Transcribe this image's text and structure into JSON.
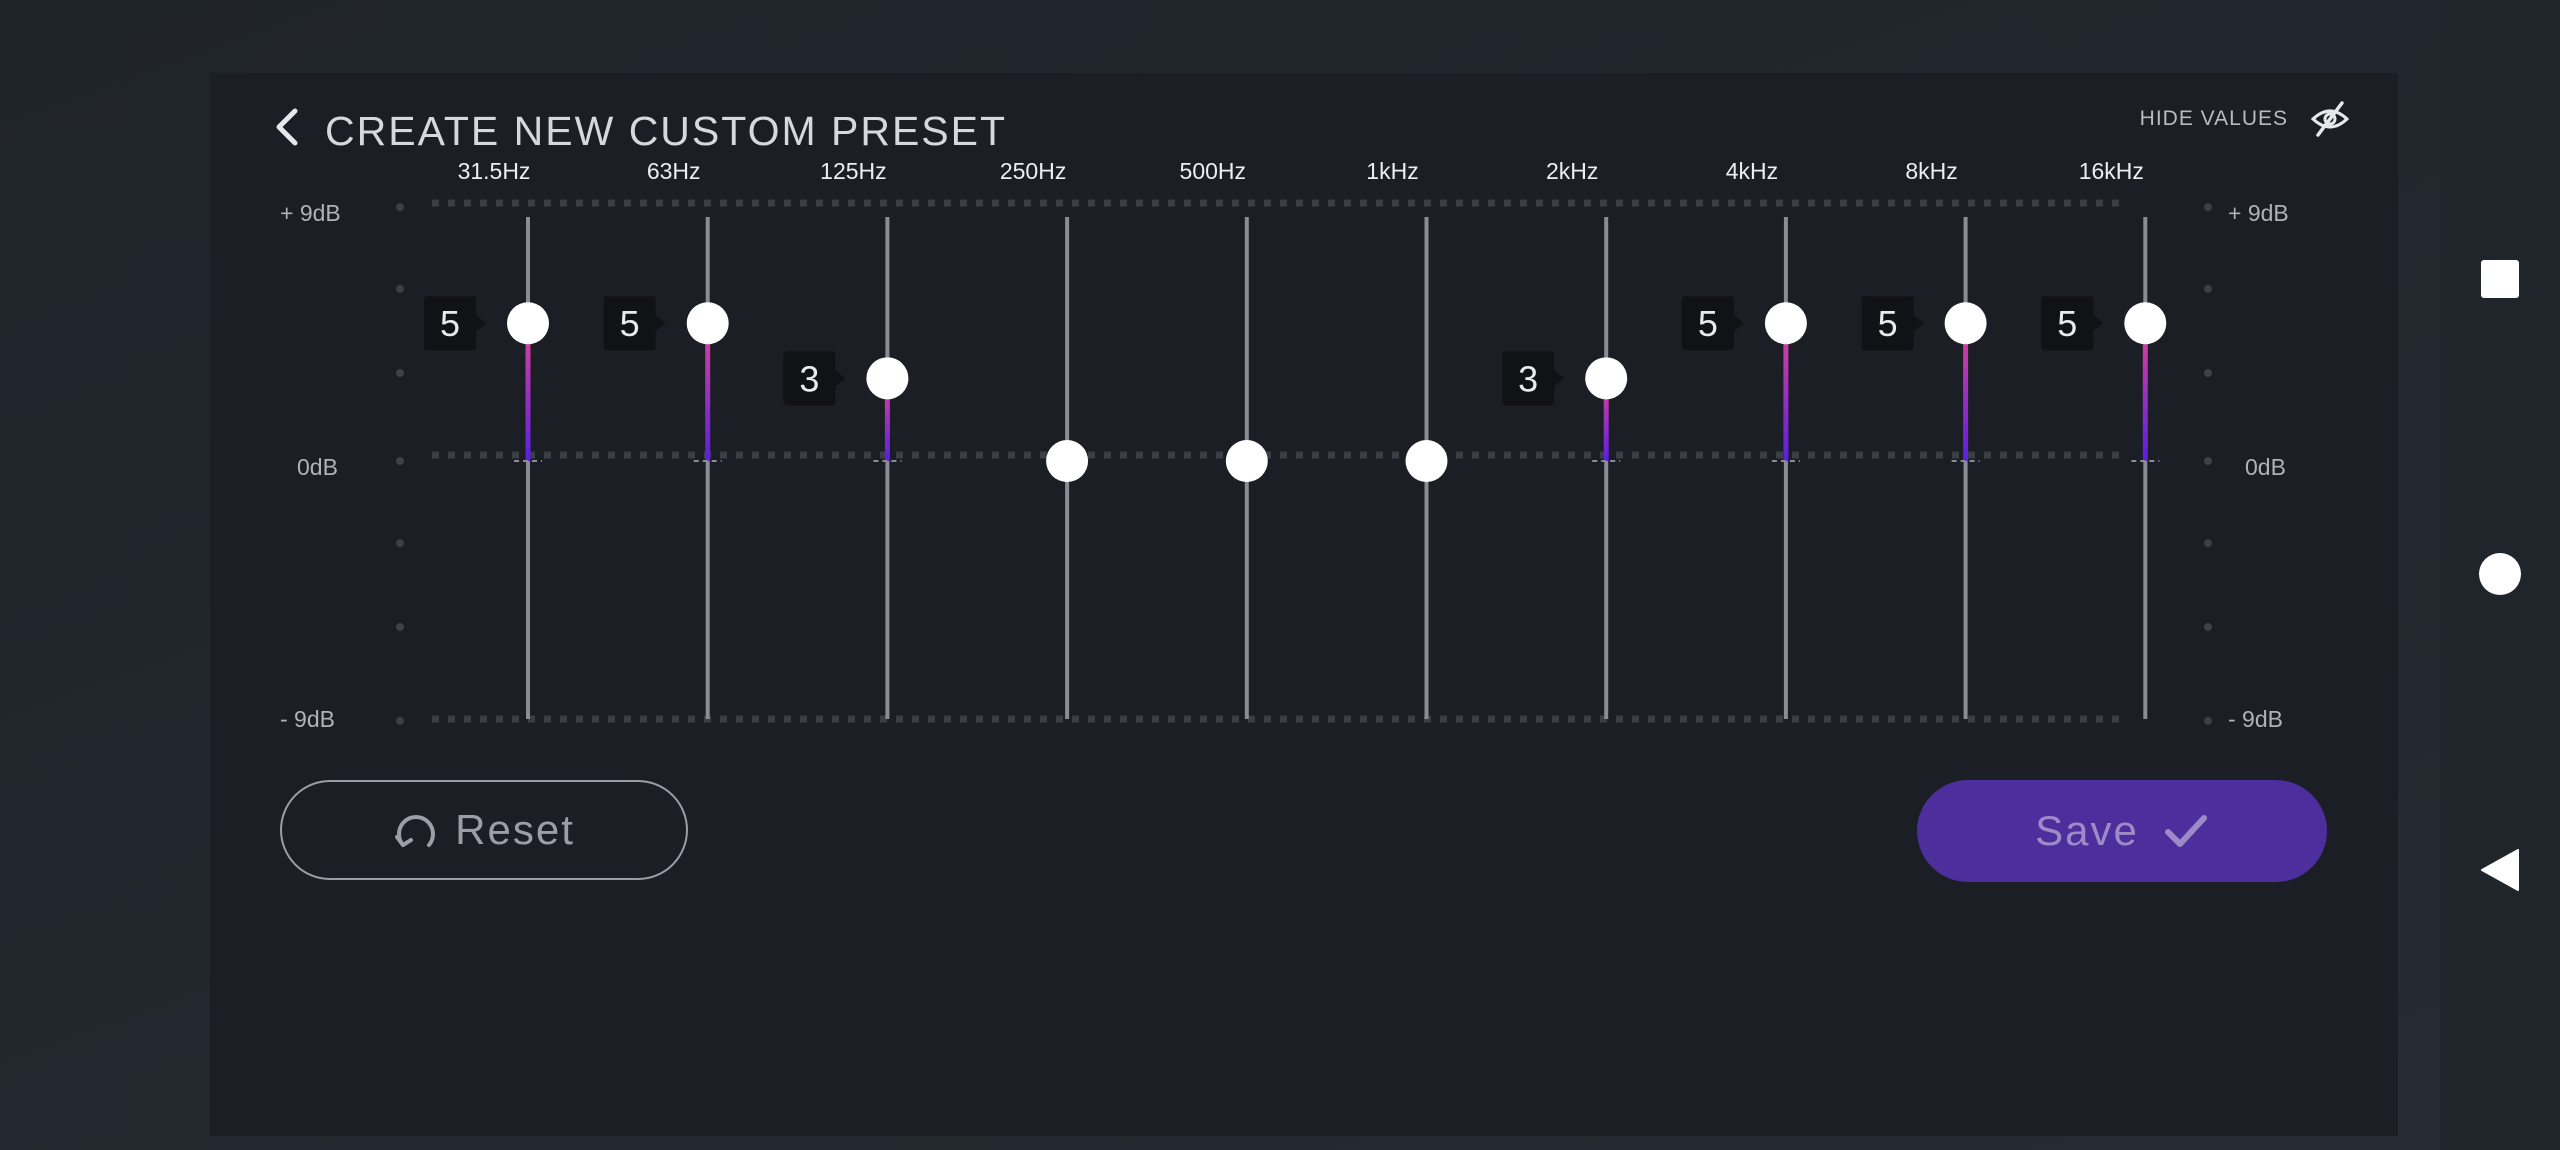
{
  "header": {
    "title": "CREATE NEW CUSTOM PRESET",
    "hide_values_label": "HIDE VALUES"
  },
  "scale": {
    "top_left": "+ 9dB",
    "mid_left": "0dB",
    "bottom_left": "- 9dB",
    "top_right": "+ 9dB",
    "mid_right": "0dB",
    "bottom_right": "- 9dB",
    "min": -9,
    "max": 9
  },
  "bands": [
    {
      "label": "31.5Hz",
      "value": 5
    },
    {
      "label": "63Hz",
      "value": 5
    },
    {
      "label": "125Hz",
      "value": 3
    },
    {
      "label": "250Hz",
      "value": 0
    },
    {
      "label": "500Hz",
      "value": 0
    },
    {
      "label": "1kHz",
      "value": 0
    },
    {
      "label": "2kHz",
      "value": 3
    },
    {
      "label": "4kHz",
      "value": 5
    },
    {
      "label": "8kHz",
      "value": 5
    },
    {
      "label": "16kHz",
      "value": 5
    }
  ],
  "actions": {
    "reset_label": "Reset",
    "save_label": "Save"
  },
  "colors": {
    "accent": "#4c2e9c",
    "fill_top": "#e0439a",
    "fill_bottom": "#5b1ee0"
  },
  "icons": {
    "back": "chevron-left-icon",
    "hide_values": "eye-off-icon",
    "reset": "reset-icon",
    "save": "checkmark-icon",
    "nav_square": "square-icon",
    "nav_circle": "circle-icon",
    "nav_back": "triangle-left-icon"
  }
}
